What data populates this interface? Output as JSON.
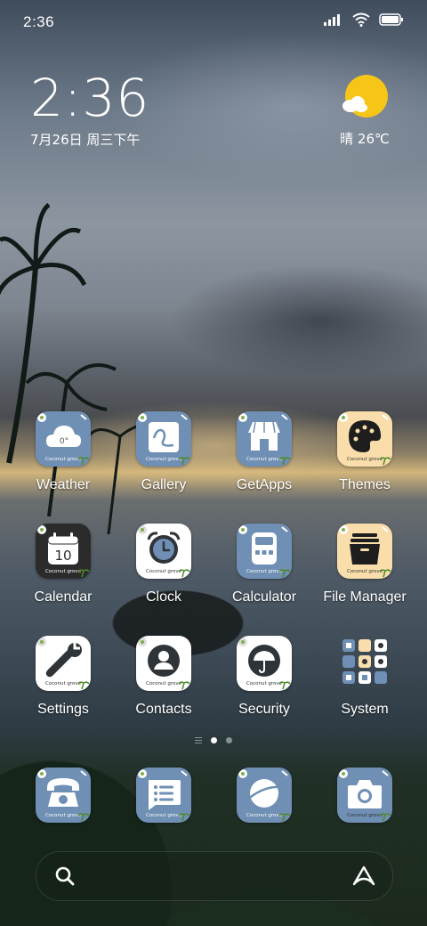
{
  "status_bar": {
    "time": "2:36",
    "icons": [
      "signal-icon",
      "wifi-icon",
      "battery-icon"
    ]
  },
  "clock_widget": {
    "time": "2:36",
    "date": "7月26日 周三下午"
  },
  "weather_widget": {
    "icon": "sunny-partly-cloudy-icon",
    "text": "晴 26℃"
  },
  "icon_theme_caption": "Coconut grove",
  "apps": [
    {
      "label": "Weather",
      "icon": "weather-cloud-icon",
      "badge": "0°"
    },
    {
      "label": "Gallery",
      "icon": "gallery-icon"
    },
    {
      "label": "GetApps",
      "icon": "store-icon"
    },
    {
      "label": "Themes",
      "icon": "palette-icon"
    },
    {
      "label": "Calendar",
      "icon": "calendar-icon",
      "badge": "10"
    },
    {
      "label": "Clock",
      "icon": "alarm-clock-icon"
    },
    {
      "label": "Calculator",
      "icon": "calculator-icon"
    },
    {
      "label": "File Manager",
      "icon": "folder-icon"
    },
    {
      "label": "Settings",
      "icon": "wrench-icon"
    },
    {
      "label": "Contacts",
      "icon": "contact-icon"
    },
    {
      "label": "Security",
      "icon": "umbrella-shield-icon"
    },
    {
      "label": "System",
      "icon": "folder-grid-icon"
    }
  ],
  "page_indicator": {
    "pages": 2,
    "current": 1
  },
  "dock": [
    {
      "icon": "phone-icon"
    },
    {
      "icon": "messages-icon"
    },
    {
      "icon": "browser-icon"
    },
    {
      "icon": "camera-icon"
    }
  ],
  "search_bar": {
    "search_icon": "search-icon",
    "assistant_icon": "assistant-icon"
  },
  "colors": {
    "icon_blue": "#6f8fb4",
    "icon_yellow": "#f9deab",
    "icon_dark": "#2b2b2b",
    "sun_yellow": "#f5c518"
  }
}
